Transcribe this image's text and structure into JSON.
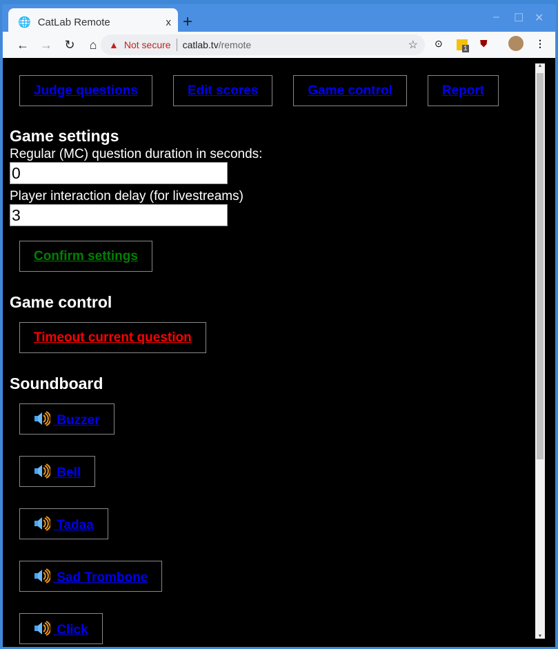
{
  "browser": {
    "tab_title": "CatLab Remote",
    "tab_close": "x",
    "new_tab": "+",
    "security": "Not secure",
    "url_host": "catlab.tv",
    "url_path": "/remote",
    "ext_badge": "1"
  },
  "nav": [
    {
      "label": "Judge questions"
    },
    {
      "label": "Edit scores"
    },
    {
      "label": "Game control"
    },
    {
      "label": "Report"
    }
  ],
  "settings": {
    "heading": "Game settings",
    "duration_label": "Regular (MC) question duration in seconds:",
    "duration_value": "0",
    "delay_label": "Player interaction delay (for livestreams)",
    "delay_value": "3",
    "confirm": "Confirm settings",
    "confirm_color": "#008000"
  },
  "control": {
    "heading": "Game control",
    "timeout": "Timeout current question",
    "timeout_color": "#ff0000"
  },
  "soundboard": {
    "heading": "Soundboard",
    "icon": "speaker-icon",
    "sounds": [
      " Buzzer",
      " Bell",
      " Tadaa",
      " Sad Trombone",
      " Click"
    ]
  }
}
